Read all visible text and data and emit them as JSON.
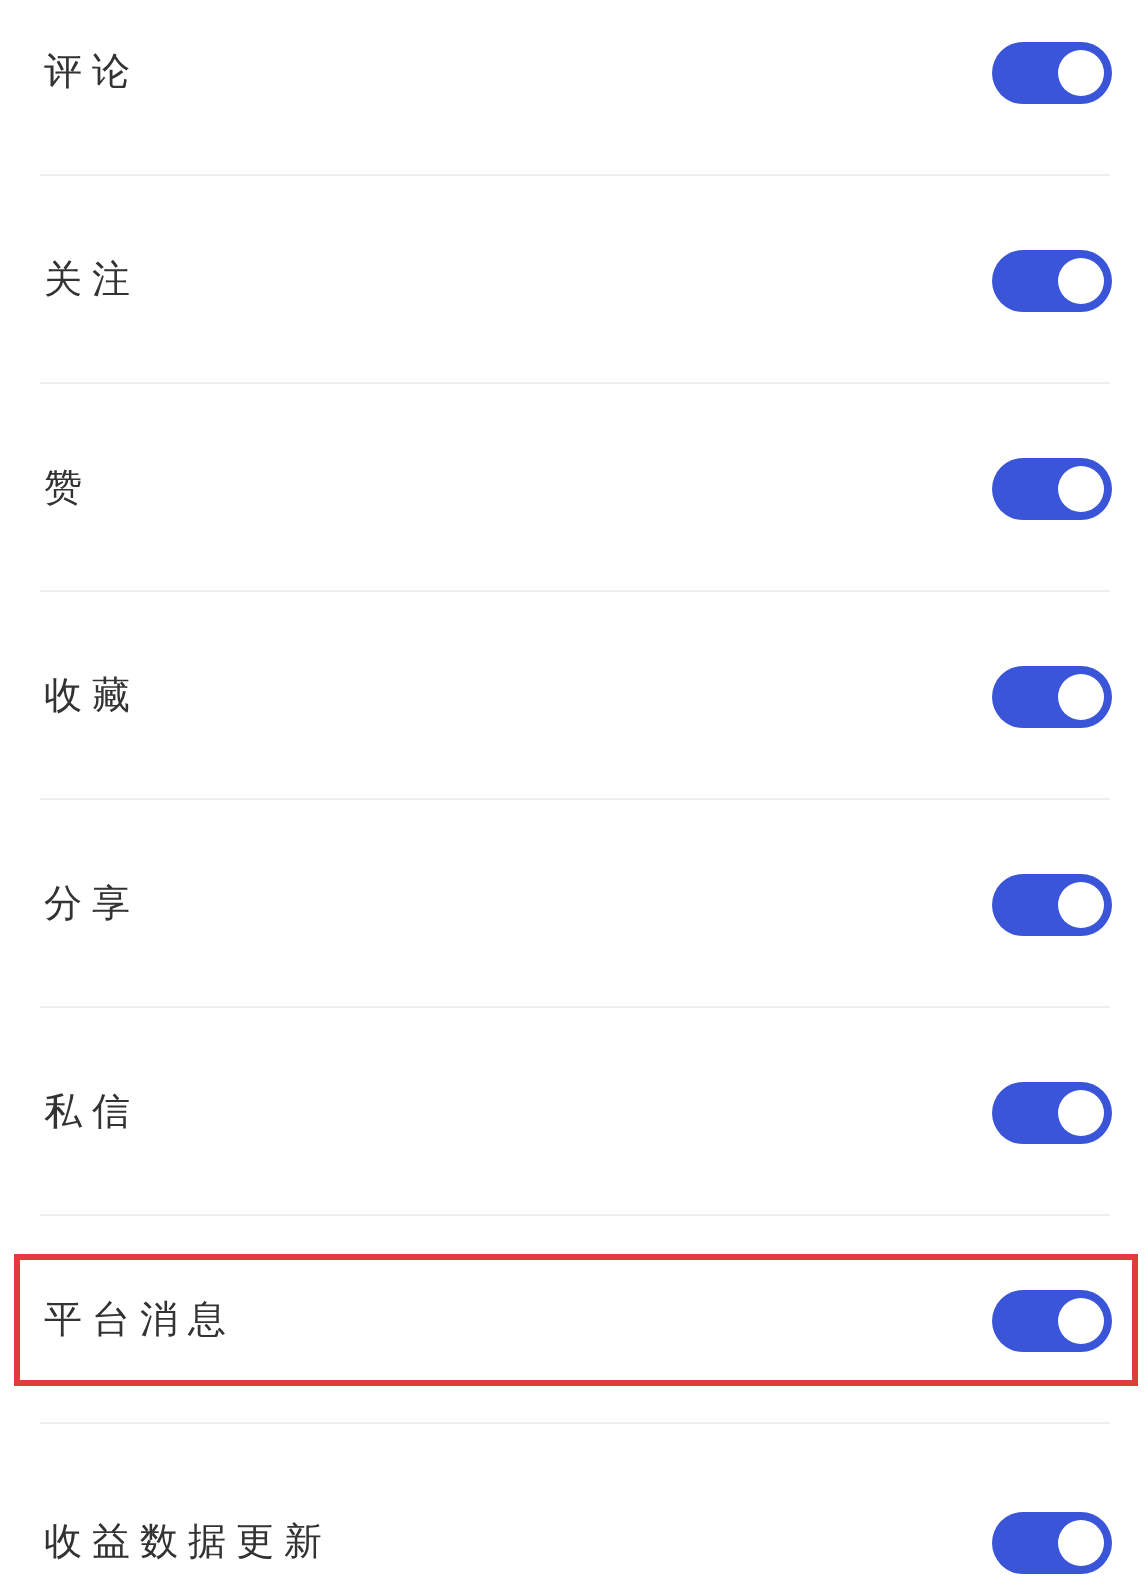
{
  "settings": [
    {
      "label": "评论",
      "on": true,
      "highlighted": false
    },
    {
      "label": "关注",
      "on": true,
      "highlighted": false
    },
    {
      "label": "赞",
      "on": true,
      "highlighted": false
    },
    {
      "label": "收藏",
      "on": true,
      "highlighted": false
    },
    {
      "label": "分享",
      "on": true,
      "highlighted": false
    },
    {
      "label": "私信",
      "on": true,
      "highlighted": false
    },
    {
      "label": "平台消息",
      "on": true,
      "highlighted": true
    },
    {
      "label": "收益数据更新",
      "on": true,
      "highlighted": false
    }
  ]
}
